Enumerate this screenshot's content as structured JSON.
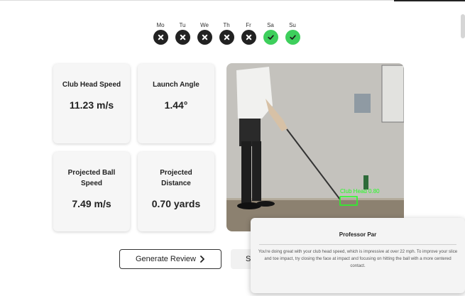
{
  "week": {
    "days": [
      {
        "label": "Mo",
        "status": "missed",
        "icon": "x-icon"
      },
      {
        "label": "Tu",
        "status": "missed",
        "icon": "x-icon"
      },
      {
        "label": "We",
        "status": "missed",
        "icon": "x-icon"
      },
      {
        "label": "Th",
        "status": "missed",
        "icon": "x-icon"
      },
      {
        "label": "Fr",
        "status": "missed",
        "icon": "x-icon"
      },
      {
        "label": "Sa",
        "status": "completed",
        "icon": "check-icon"
      },
      {
        "label": "Su",
        "status": "completed",
        "icon": "check-icon"
      }
    ]
  },
  "metrics": {
    "club_head_speed": {
      "title": "Club Head Speed",
      "value": "11.23 m/s"
    },
    "launch_angle": {
      "title": "Launch Angle",
      "value": "1.44°"
    },
    "ball_speed": {
      "title": "Projected Ball Speed",
      "value": "7.49 m/s"
    },
    "distance": {
      "title": "Projected Distance",
      "value": "0.70 yards"
    }
  },
  "video": {
    "detection_label": "Club Head 0.80"
  },
  "buttons": {
    "generate_review": "Generate Review",
    "second_label": "S"
  },
  "popup": {
    "title": "Professor Par",
    "body": "You're doing great with your club head speed, which is impressive at over 22 mph. To improve your slice and toe impact, try closing the face at impact and focusing on hitting the ball with a more centered contact."
  },
  "colors": {
    "missed": "#222222",
    "completed": "#3ecf5c",
    "detection": "#22ff22"
  }
}
